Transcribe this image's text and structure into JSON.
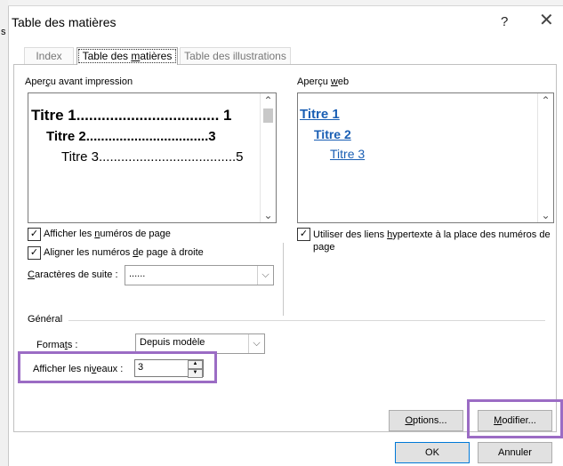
{
  "frame_letter": "s",
  "dialog": {
    "title": "Table des matières",
    "help": "?",
    "close": "✕"
  },
  "tabs": [
    {
      "label": "Index"
    },
    {
      "label_pre": "Table des ",
      "label_u": "m",
      "label_post": "atières"
    },
    {
      "label": "Table des illustrations"
    }
  ],
  "print_preview": {
    "heading_pre": "Aper",
    "heading_u": "ç",
    "heading_post": "u avant impression",
    "title1": "Titre 1.................................. 1",
    "title2": "Titre 2.................................3",
    "title3": "Titre 3.....................................5",
    "checkbox_page_numbers": {
      "checked": "✓",
      "pre": "Afficher les ",
      "u": "n",
      "post": "uméros de page"
    },
    "checkbox_align_right": {
      "checked": "✓",
      "pre": "Aligner les numéros ",
      "u": "d",
      "post": "e page à droite"
    },
    "leader_label_u": "C",
    "leader_label_post": "aractères de suite :",
    "leader_value": "......",
    "combo_arrow": "⌵"
  },
  "web_preview": {
    "heading_pre": "Aperçu ",
    "heading_u": "w",
    "heading_post": "eb",
    "title1": "Titre 1",
    "title2": "Titre 2",
    "title3": "Titre 3",
    "checkbox_hyperlinks": {
      "checked": "✓",
      "pre": "Utiliser des liens ",
      "u": "h",
      "post": "ypertexte à la place des numéros de page"
    }
  },
  "general": {
    "heading": "Général",
    "formats_pre": "Forma",
    "formats_u": "t",
    "formats_post": "s :",
    "formats_value": "Depuis modèle",
    "levels_pre": "Afficher les ni",
    "levels_u": "v",
    "levels_post": "eaux :",
    "levels_value": "3"
  },
  "buttons": {
    "options_u": "O",
    "options_post": "ptions...",
    "modify_u": "M",
    "modify_post": "odifier...",
    "ok": "OK",
    "cancel": "Annuler"
  },
  "scroll": {
    "up": "⌃",
    "down": "⌄"
  },
  "highlight_color": "#9b6cc4"
}
